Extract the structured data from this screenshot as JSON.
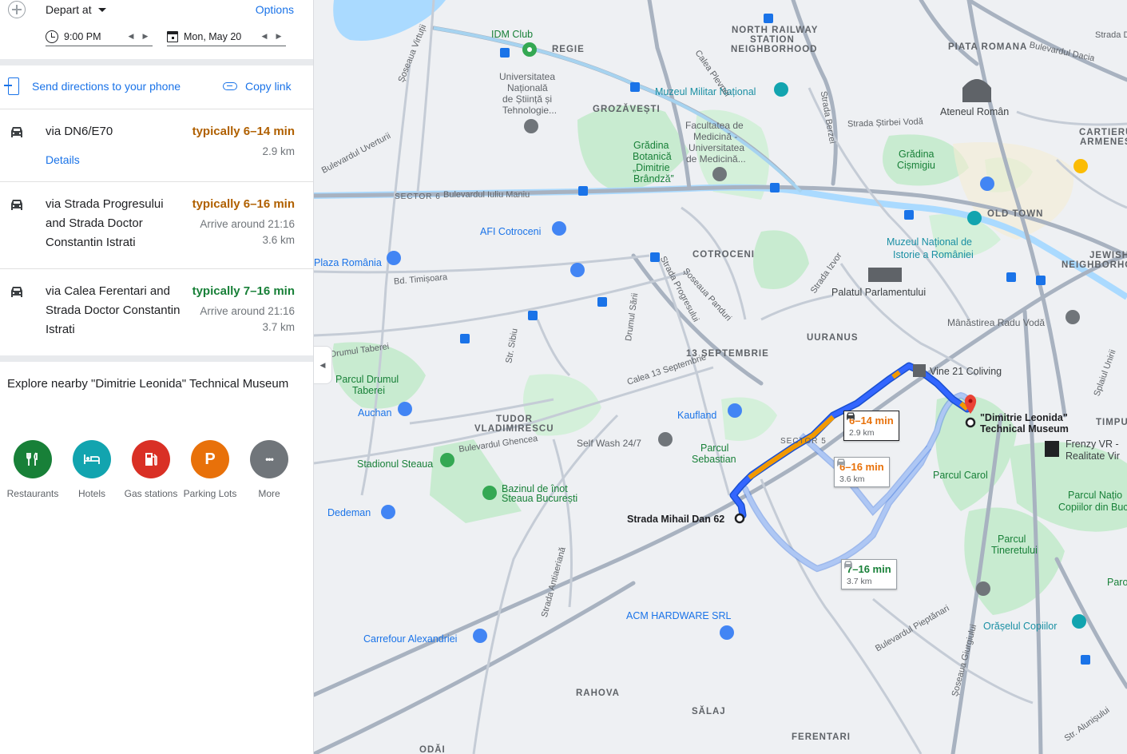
{
  "panel": {
    "depart_label": "Depart at",
    "options_label": "Options",
    "time_value": "9:00 PM",
    "date_value": "Mon, May 20",
    "send_label": "Send directions to your phone",
    "copy_label": "Copy link"
  },
  "routes": [
    {
      "title": "via DN6/E70",
      "time": "typically 6–14 min",
      "time_color": "#b06000",
      "arrive": "",
      "distance": "2.9 km",
      "details": "Details"
    },
    {
      "title": "via Strada Progresului and Strada Doctor Constantin Istrati",
      "time": "typically 6–16 min",
      "time_color": "#b06000",
      "arrive": "Arrive around 21:16",
      "distance": "3.6 km"
    },
    {
      "title": "via Calea Ferentari and Strada Doctor Constantin Istrati",
      "time": "typically 7–16 min",
      "time_color": "#188038",
      "arrive": "Arrive around 21:16",
      "distance": "3.7 km"
    }
  ],
  "explore": {
    "title": "Explore nearby \"Dimitrie Leonida\" Technical Museum",
    "categories": [
      {
        "label": "Restaurants",
        "color": "#188038",
        "icon": "fork-knife-icon"
      },
      {
        "label": "Hotels",
        "color": "#12a4af",
        "icon": "bed-icon"
      },
      {
        "label": "Gas stations",
        "color": "#d93025",
        "icon": "gas-pump-icon"
      },
      {
        "label": "Parking Lots",
        "color": "#e8710a",
        "icon": "parking-icon",
        "glyph": "P"
      },
      {
        "label": "More",
        "color": "#70757a",
        "icon": "more-icon",
        "glyph": "•••"
      }
    ]
  },
  "map": {
    "origin": "Strada Mihail Dan 62",
    "destination_line1": "\"Dimitrie Leonida\"",
    "destination_line2": "Technical Museum",
    "bubbles": [
      {
        "time": "6–14 min",
        "dist": "2.9 km",
        "color": "#e8710a"
      },
      {
        "time": "6–16 min",
        "dist": "3.6 km",
        "color": "#e8710a"
      },
      {
        "time": "7–16 min",
        "dist": "3.7 km",
        "color": "#188038"
      }
    ],
    "districts": [
      "REGIE",
      "GROZĂVEȘTI",
      "NORTH RAILWAY",
      "STATION",
      "NEIGHBORHOOD",
      "PIATA ROMANA",
      "CARTIERUL",
      "ARMENESC",
      "OLD TOWN",
      "JEWISH",
      "NEIGHBORHOOD",
      "COTROCENI",
      "UURANUS",
      "13 SEPTEMBRIE",
      "TUDOR",
      "VLADIMIRESCU",
      "RAHOVA",
      "SĂLAJ",
      "FERENTARI",
      "ODĂI",
      "SECTOR 5",
      "SECTOR 6"
    ],
    "pois": {
      "idm": "IDM Club",
      "unis1": "Universitatea",
      "unis2": "Națională",
      "unis3": "de Știință și",
      "unis4": "Tehnologie...",
      "muzeu_militar": "Muzeul Militar Național",
      "facultatea1": "Facultatea de",
      "facultatea2": "Medicină -",
      "facultatea3": "Universitatea",
      "facultatea4": "de Medicină...",
      "gradina_bot1": "Grădina",
      "gradina_bot2": "Botanică",
      "gradina_bot3": "„Dimitrie",
      "gradina_bot4": "Brândză”",
      "gradina_cis1": "Grădina",
      "gradina_cis2": "Cișmigiu",
      "ateneul": "Ateneul Român",
      "afi": "AFI Cotroceni",
      "plaza": "Plaza România",
      "muzeul_ist1": "Muzeul Național de",
      "muzeul_ist2": "Istorie a României",
      "palatul": "Palatul Parlamentului",
      "radu": "Mânăstirea Radu Vodă",
      "vine": "Vine 21 Coliving",
      "parcul_drumul1": "Parcul Drumul",
      "parcul_drumul2": "Taberei",
      "auchan": "Auchan",
      "kaufland": "Kaufland",
      "selfwash": "Self Wash 24/7",
      "sebastian1": "Parcul",
      "sebastian2": "Sebastian",
      "stadionul": "Stadionul Steaua",
      "bazinul1": "Bazinul de înot",
      "bazinul2": "Steaua București",
      "dedeman": "Dedeman",
      "acm": "ACM HARDWARE SRL",
      "carrefour": "Carrefour Alexandriei",
      "parcul_carol": "Parcul Carol",
      "frenzy1": "Frenzy VR -",
      "frenzy2": "Realitate Vir",
      "timpu": "TIMPU",
      "parcul_nat1": "Parcul Națio",
      "parcul_nat2": "Copiilor din Buc",
      "parcul_tin1": "Parcul",
      "parcul_tin2": "Tineretului",
      "orasul": "Orășelul Copiilor",
      "paro": "Paro"
    },
    "streets": {
      "bd_maniu": "Bulevardul Iuliu Maniu",
      "bd_timisoara": "Bd. Timișoara",
      "drumul_taberei": "Drumul Taberei",
      "calea_13": "Calea 13 Septembrie",
      "bd_ghencea": "Bulevardul Ghencea",
      "str_sibiu": "Str. Sibiu",
      "drumul_sarii": "Drumul Sării",
      "strada_progresului": "Strada Progresului",
      "soseaua_panduri": "Șoseaua Panduri",
      "strada_izvor": "Strada Izvor",
      "strada_stirbei": "Strada Știrbei Vodă",
      "strada_berzei": "Strada Berzei",
      "calea_plevnei": "Calea Plevnei",
      "soseaua_virtuti": "Șoseaua Virtuții",
      "bd_uverturii": "Bulevardul Uverturii",
      "strada_antiaeriana": "Strada Antiaeriană",
      "bd_piepterari": "Bulevardul Pieptănari",
      "soseaua_giurgiului": "Șoseaua Giurgiului",
      "str_alunisului": "Str. Alunișului",
      "splaiul": "Splaiul Unirii",
      "bd_dacia": "Bulevardul Dacia",
      "strada_d": "Strada D"
    }
  }
}
